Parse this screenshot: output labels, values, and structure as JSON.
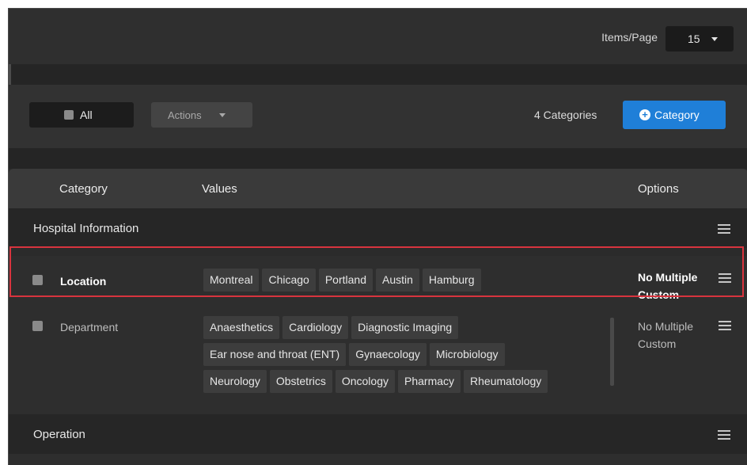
{
  "pagination": {
    "items_label": "Items/Page",
    "items_value": "15"
  },
  "toolbar": {
    "all_label": "All",
    "actions_label": "Actions",
    "count_text": "4 Categories",
    "add_category_label": "Category",
    "add_category_icon": "plus-circle-icon",
    "accent_color": "#1f7fd8"
  },
  "table": {
    "columns": [
      "Category",
      "Values",
      "Options"
    ],
    "groups": [
      {
        "title": "Hospital Information",
        "rows": [
          {
            "name": "Location",
            "values": [
              "Montreal",
              "Chicago",
              "Portland",
              "Austin",
              "Hamburg"
            ],
            "options": [
              "No Multiple",
              "Custom"
            ],
            "highlighted": true
          },
          {
            "name": "Department",
            "values": [
              "Anaesthetics",
              "Cardiology",
              "Diagnostic Imaging",
              "Ear nose and throat (ENT)",
              "Gynaecology",
              "Microbiology",
              "Neurology",
              "Obstetrics",
              "Oncology",
              "Pharmacy",
              "Rheumatology"
            ],
            "options": [
              "No Multiple",
              "Custom"
            ],
            "highlighted": false
          }
        ]
      },
      {
        "title": "Operation",
        "rows": []
      }
    ]
  },
  "colors": {
    "highlight_border": "#d8343e"
  }
}
